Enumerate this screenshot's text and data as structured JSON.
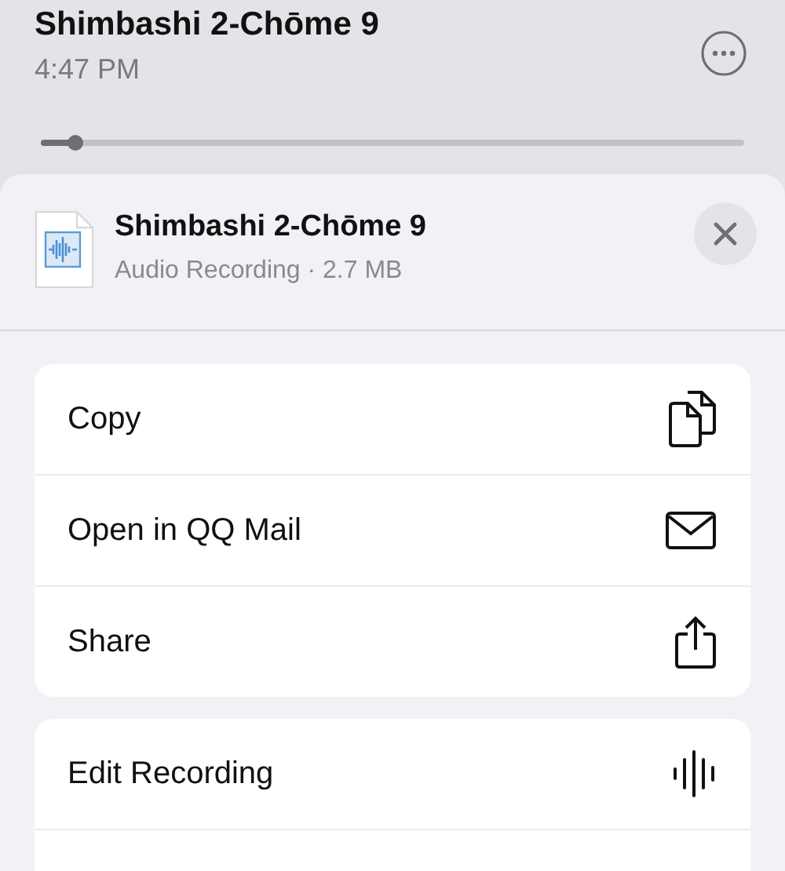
{
  "recording": {
    "title": "Shimbashi 2-Chōme 9",
    "time": "4:47 PM",
    "playback": {
      "level": 0.05
    }
  },
  "sheet": {
    "file": {
      "title": "Shimbashi 2-Chōme 9",
      "subtitle": "Audio Recording · 2.7 MB"
    },
    "groups": [
      [
        {
          "label": "Copy",
          "kind": "copy"
        },
        {
          "label": "Open in QQ Mail",
          "kind": "mail"
        },
        {
          "label": "Share",
          "kind": "share"
        }
      ],
      [
        {
          "label": "Edit Recording",
          "kind": "waveform"
        },
        {
          "kind": "hidden"
        }
      ]
    ]
  }
}
